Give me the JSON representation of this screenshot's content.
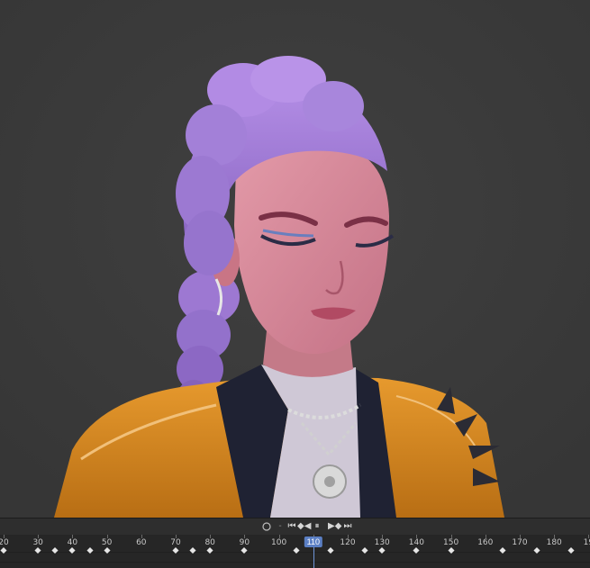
{
  "transport": {
    "record_icon": "circle-icon",
    "separator": "-",
    "go_start": "⏮",
    "step_back": "◆◀",
    "pause": "⏸",
    "step_forward": "▶◆",
    "go_end": "⏭"
  },
  "ruler": {
    "ticks": [
      "20",
      "30",
      "40",
      "50",
      "60",
      "70",
      "80",
      "90",
      "100",
      "110",
      "120",
      "130",
      "140",
      "150",
      "160",
      "170",
      "180",
      "19"
    ],
    "current_frame": "110",
    "keyframes": [
      20,
      30,
      35,
      40,
      45,
      50,
      70,
      75,
      80,
      90,
      105,
      115,
      125,
      130,
      140,
      150,
      165,
      175,
      185
    ]
  },
  "colors": {
    "hair": "#a583d8",
    "jacket": "#d9891f",
    "skin": "#d98a9a",
    "playhead": "#5b7fc4"
  }
}
